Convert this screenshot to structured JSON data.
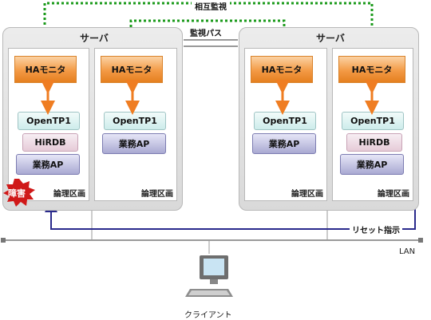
{
  "top_label": "相互監視",
  "monitor_path_label": "監視パス",
  "reset_label": "リセット指示",
  "lan_label": "LAN",
  "client_label": "クライアント",
  "fault_label": "障害",
  "servers": [
    {
      "title": "サーバ",
      "partitions": [
        {
          "ha": "HAモニタ",
          "otp": "OpenTP1",
          "hirdb": "HiRDB",
          "ap": "業務AP",
          "label": "論理区画"
        },
        {
          "ha": "HAモニタ",
          "otp": "OpenTP1",
          "ap": "業務AP",
          "label": "論理区画"
        }
      ]
    },
    {
      "title": "サーバ",
      "partitions": [
        {
          "ha": "HAモニタ",
          "otp": "OpenTP1",
          "ap": "業務AP",
          "label": "論理区画"
        },
        {
          "ha": "HAモニタ",
          "otp": "OpenTP1",
          "hirdb": "HiRDB",
          "ap": "業務AP",
          "label": "論理区画"
        }
      ]
    }
  ],
  "colors": {
    "dotted_green": "#1a9a1a",
    "orange_arrow": "#ef7d22",
    "reset_line": "#2a2a8c",
    "fault_red": "#d01818"
  }
}
